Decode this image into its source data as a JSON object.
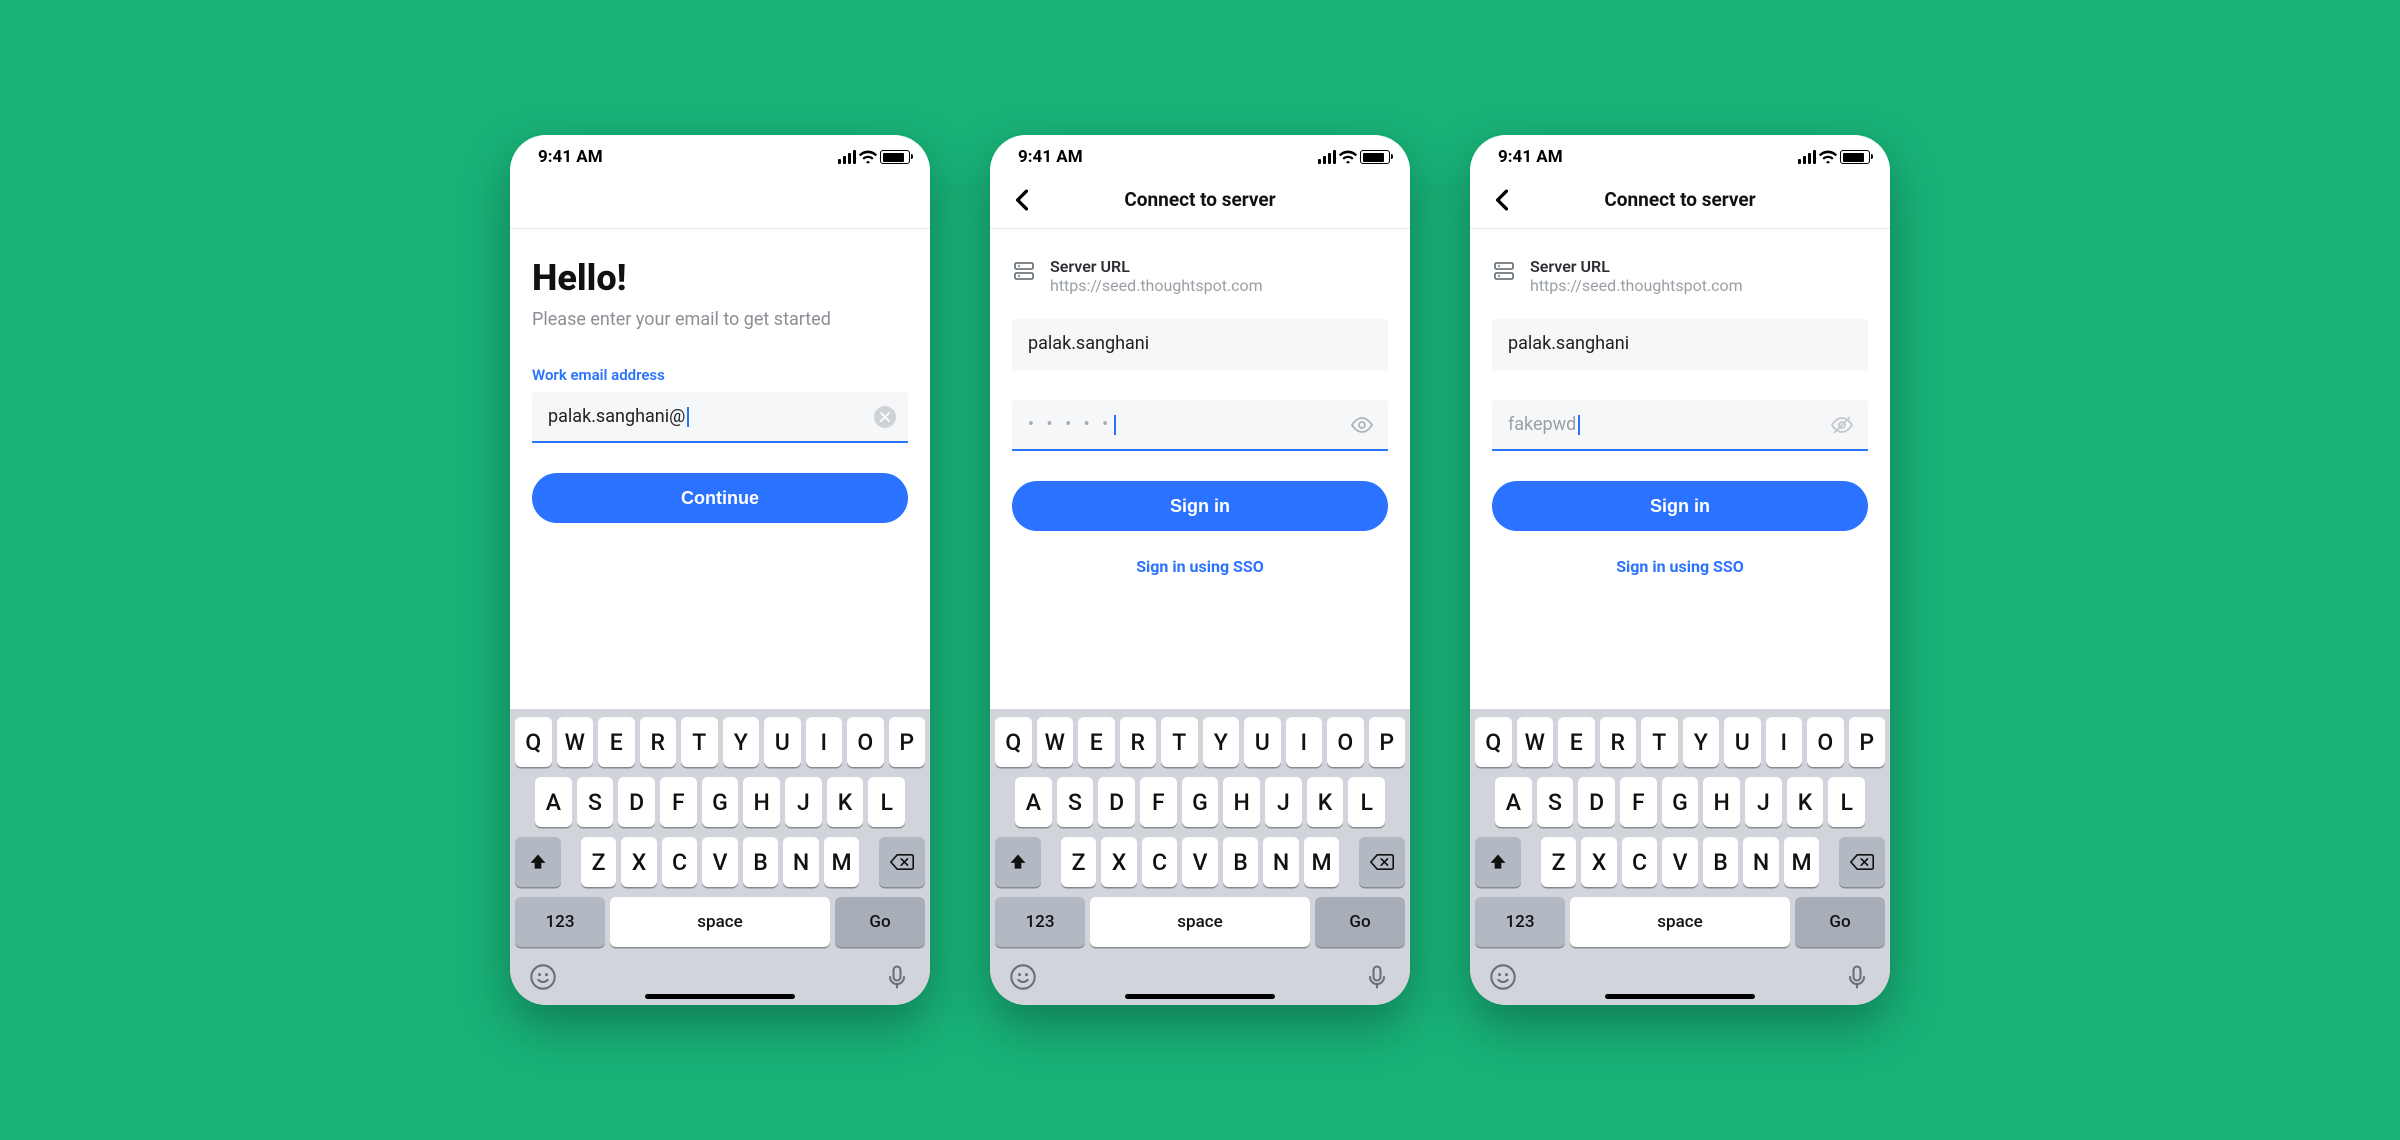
{
  "colors": {
    "accent": "#2a72ff",
    "bg": "#18b277"
  },
  "status": {
    "time": "9:41 AM"
  },
  "keyboard": {
    "row1": [
      "Q",
      "W",
      "E",
      "R",
      "T",
      "Y",
      "U",
      "I",
      "O",
      "P"
    ],
    "row2": [
      "A",
      "S",
      "D",
      "F",
      "G",
      "H",
      "J",
      "K",
      "L"
    ],
    "row3": [
      "Z",
      "X",
      "C",
      "V",
      "B",
      "N",
      "M"
    ],
    "num": "123",
    "space": "space",
    "go": "Go"
  },
  "screen1": {
    "greeting": "Hello!",
    "subtitle": "Please enter your email to get started",
    "email_label": "Work email address",
    "email_value": "palak.sanghani@",
    "continue": "Continue"
  },
  "screen2": {
    "title": "Connect to server",
    "server_label": "Server URL",
    "server_value": "https://seed.thoughtspot.com",
    "username": "palak.sanghani",
    "password_masked": "• • • • •",
    "signin": "Sign in",
    "sso": "Sign in using SSO"
  },
  "screen3": {
    "title": "Connect to server",
    "server_label": "Server URL",
    "server_value": "https://seed.thoughtspot.com",
    "username": "palak.sanghani",
    "password_plain": "fakepwd",
    "signin": "Sign in",
    "sso": "Sign in using SSO"
  }
}
